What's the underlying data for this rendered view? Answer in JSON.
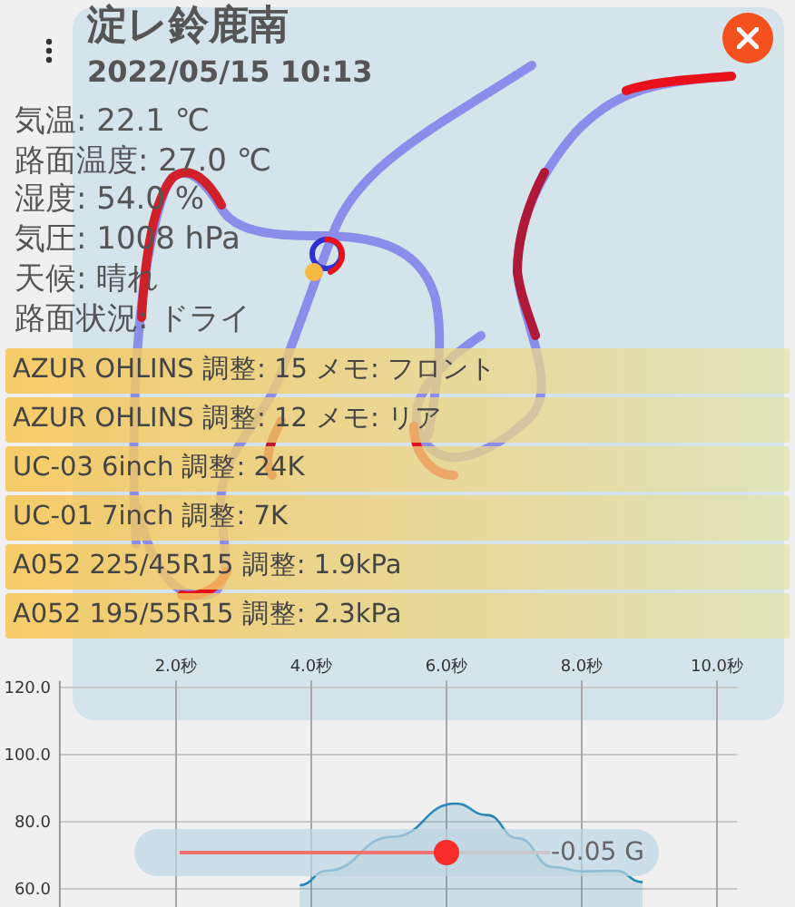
{
  "header": {
    "title": "淀レ鈴鹿南",
    "datetime": "2022/05/15 10:13"
  },
  "conditions": [
    "気温: 22.1 ℃",
    "路面温度: 27.0 ℃",
    "湿度: 54.0 %",
    "気圧: 1008 hPa",
    "天候: 晴れ",
    "路面状況: ドライ"
  ],
  "setups": [
    "AZUR OHLINS 調整: 15 メモ: フロント",
    "AZUR OHLINS 調整: 12 メモ: リア",
    "UC-03 6inch 調整: 24K",
    "UC-01 7inch 調整: 7K",
    "A052 225/45R15 調整: 1.9kPa",
    "A052 195/55R15 調整: 2.3kPa"
  ],
  "chart": {
    "chart_data": {
      "type": "area",
      "x": [
        3.83,
        4.23,
        5.2,
        6.13,
        6.6,
        7.05,
        7.58,
        8.0,
        8.5,
        8.9
      ],
      "xlim": [
        0.28,
        10.3
      ],
      "ylim": [
        54.6,
        122
      ],
      "grid": true,
      "series": [
        {
          "color": "#2a88b8",
          "values": [
            61.1,
            65.4,
            75.5,
            85.4,
            82.0,
            75.1,
            66.5,
            65.2,
            65.4,
            62.0
          ]
        }
      ],
      "xticks": [
        {
          "value": 2,
          "label": "2.0秒"
        },
        {
          "value": 4,
          "label": "4.0秒"
        },
        {
          "value": 6,
          "label": "6.0秒"
        },
        {
          "value": 8,
          "label": "8.0秒"
        },
        {
          "value": 10,
          "label": "10.0秒"
        }
      ],
      "yticks": [
        {
          "value": 60,
          "label": "60.0"
        },
        {
          "value": 80,
          "label": "80.0"
        },
        {
          "value": 100,
          "label": "100.0"
        },
        {
          "value": 120,
          "label": "120.0"
        }
      ]
    }
  },
  "g_slider": {
    "level": 0.72,
    "reading": "-0.05 G"
  }
}
